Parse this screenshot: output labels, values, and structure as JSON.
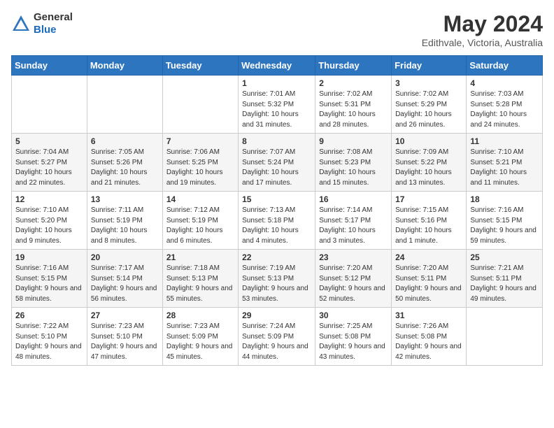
{
  "logo": {
    "general": "General",
    "blue": "Blue"
  },
  "title": "May 2024",
  "location": "Edithvale, Victoria, Australia",
  "days_of_week": [
    "Sunday",
    "Monday",
    "Tuesday",
    "Wednesday",
    "Thursday",
    "Friday",
    "Saturday"
  ],
  "weeks": [
    [
      {
        "day": "",
        "info": ""
      },
      {
        "day": "",
        "info": ""
      },
      {
        "day": "",
        "info": ""
      },
      {
        "day": "1",
        "info": "Sunrise: 7:01 AM\nSunset: 5:32 PM\nDaylight: 10 hours and 31 minutes."
      },
      {
        "day": "2",
        "info": "Sunrise: 7:02 AM\nSunset: 5:31 PM\nDaylight: 10 hours and 28 minutes."
      },
      {
        "day": "3",
        "info": "Sunrise: 7:02 AM\nSunset: 5:29 PM\nDaylight: 10 hours and 26 minutes."
      },
      {
        "day": "4",
        "info": "Sunrise: 7:03 AM\nSunset: 5:28 PM\nDaylight: 10 hours and 24 minutes."
      }
    ],
    [
      {
        "day": "5",
        "info": "Sunrise: 7:04 AM\nSunset: 5:27 PM\nDaylight: 10 hours and 22 minutes."
      },
      {
        "day": "6",
        "info": "Sunrise: 7:05 AM\nSunset: 5:26 PM\nDaylight: 10 hours and 21 minutes."
      },
      {
        "day": "7",
        "info": "Sunrise: 7:06 AM\nSunset: 5:25 PM\nDaylight: 10 hours and 19 minutes."
      },
      {
        "day": "8",
        "info": "Sunrise: 7:07 AM\nSunset: 5:24 PM\nDaylight: 10 hours and 17 minutes."
      },
      {
        "day": "9",
        "info": "Sunrise: 7:08 AM\nSunset: 5:23 PM\nDaylight: 10 hours and 15 minutes."
      },
      {
        "day": "10",
        "info": "Sunrise: 7:09 AM\nSunset: 5:22 PM\nDaylight: 10 hours and 13 minutes."
      },
      {
        "day": "11",
        "info": "Sunrise: 7:10 AM\nSunset: 5:21 PM\nDaylight: 10 hours and 11 minutes."
      }
    ],
    [
      {
        "day": "12",
        "info": "Sunrise: 7:10 AM\nSunset: 5:20 PM\nDaylight: 10 hours and 9 minutes."
      },
      {
        "day": "13",
        "info": "Sunrise: 7:11 AM\nSunset: 5:19 PM\nDaylight: 10 hours and 8 minutes."
      },
      {
        "day": "14",
        "info": "Sunrise: 7:12 AM\nSunset: 5:19 PM\nDaylight: 10 hours and 6 minutes."
      },
      {
        "day": "15",
        "info": "Sunrise: 7:13 AM\nSunset: 5:18 PM\nDaylight: 10 hours and 4 minutes."
      },
      {
        "day": "16",
        "info": "Sunrise: 7:14 AM\nSunset: 5:17 PM\nDaylight: 10 hours and 3 minutes."
      },
      {
        "day": "17",
        "info": "Sunrise: 7:15 AM\nSunset: 5:16 PM\nDaylight: 10 hours and 1 minute."
      },
      {
        "day": "18",
        "info": "Sunrise: 7:16 AM\nSunset: 5:15 PM\nDaylight: 9 hours and 59 minutes."
      }
    ],
    [
      {
        "day": "19",
        "info": "Sunrise: 7:16 AM\nSunset: 5:15 PM\nDaylight: 9 hours and 58 minutes."
      },
      {
        "day": "20",
        "info": "Sunrise: 7:17 AM\nSunset: 5:14 PM\nDaylight: 9 hours and 56 minutes."
      },
      {
        "day": "21",
        "info": "Sunrise: 7:18 AM\nSunset: 5:13 PM\nDaylight: 9 hours and 55 minutes."
      },
      {
        "day": "22",
        "info": "Sunrise: 7:19 AM\nSunset: 5:13 PM\nDaylight: 9 hours and 53 minutes."
      },
      {
        "day": "23",
        "info": "Sunrise: 7:20 AM\nSunset: 5:12 PM\nDaylight: 9 hours and 52 minutes."
      },
      {
        "day": "24",
        "info": "Sunrise: 7:20 AM\nSunset: 5:11 PM\nDaylight: 9 hours and 50 minutes."
      },
      {
        "day": "25",
        "info": "Sunrise: 7:21 AM\nSunset: 5:11 PM\nDaylight: 9 hours and 49 minutes."
      }
    ],
    [
      {
        "day": "26",
        "info": "Sunrise: 7:22 AM\nSunset: 5:10 PM\nDaylight: 9 hours and 48 minutes."
      },
      {
        "day": "27",
        "info": "Sunrise: 7:23 AM\nSunset: 5:10 PM\nDaylight: 9 hours and 47 minutes."
      },
      {
        "day": "28",
        "info": "Sunrise: 7:23 AM\nSunset: 5:09 PM\nDaylight: 9 hours and 45 minutes."
      },
      {
        "day": "29",
        "info": "Sunrise: 7:24 AM\nSunset: 5:09 PM\nDaylight: 9 hours and 44 minutes."
      },
      {
        "day": "30",
        "info": "Sunrise: 7:25 AM\nSunset: 5:08 PM\nDaylight: 9 hours and 43 minutes."
      },
      {
        "day": "31",
        "info": "Sunrise: 7:26 AM\nSunset: 5:08 PM\nDaylight: 9 hours and 42 minutes."
      },
      {
        "day": "",
        "info": ""
      }
    ]
  ]
}
